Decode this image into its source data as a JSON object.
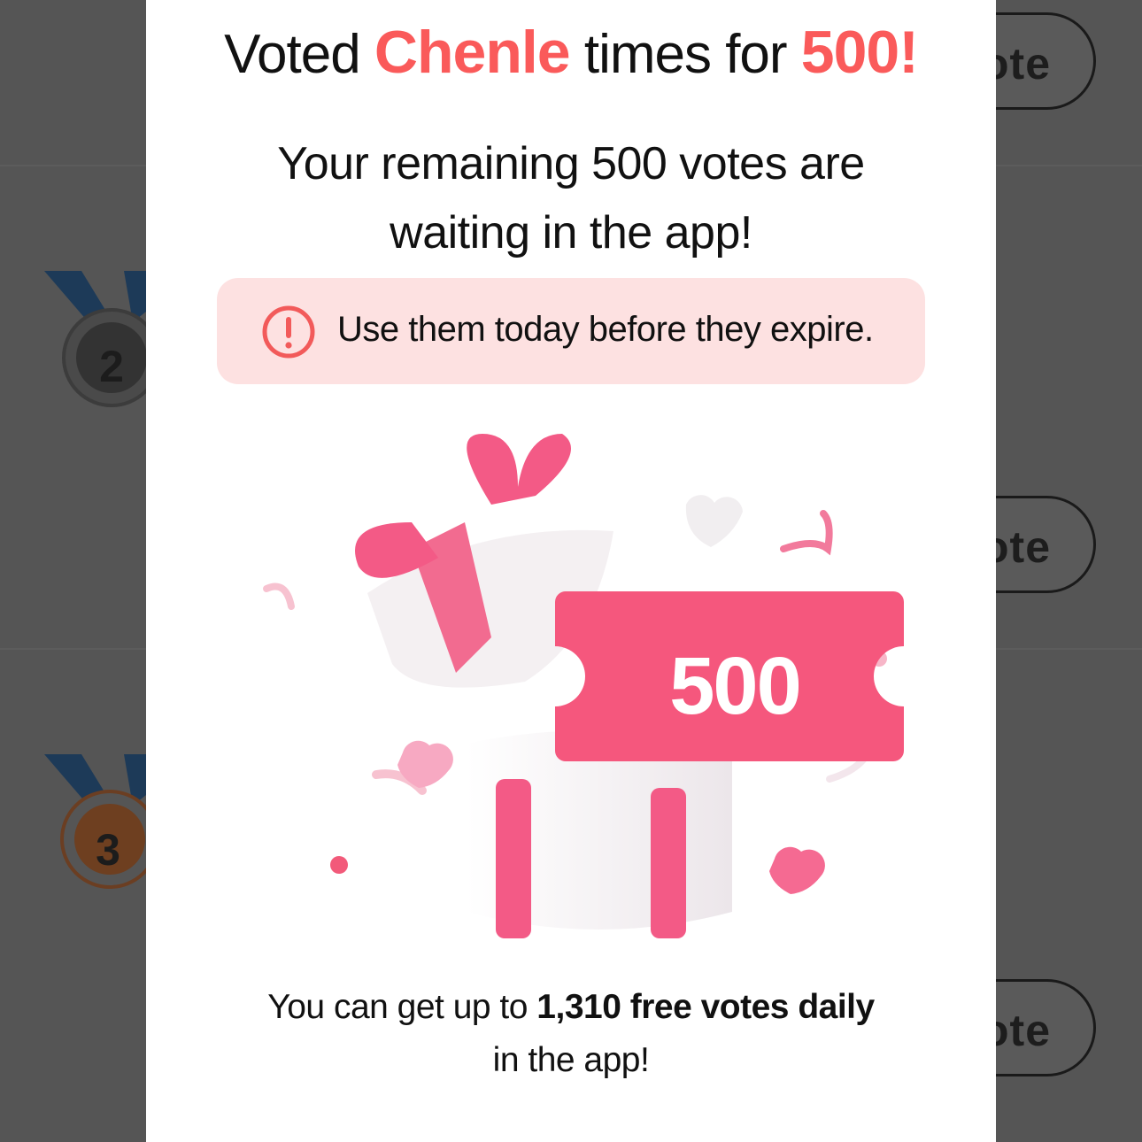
{
  "background": {
    "vote_buttons": [
      "ote",
      "ote",
      "ote"
    ],
    "medals": [
      "2",
      "3"
    ]
  },
  "modal": {
    "title_prefix": "Voted ",
    "title_name": "Chenle",
    "title_middle": " times for ",
    "title_amount": "500!",
    "subtitle_line1": "Your remaining 500 votes are",
    "subtitle_line2": "waiting in the app!",
    "warning_icon": "exclamation-circle-icon",
    "warning_text": "Use them today before they expire.",
    "ticket_value": "500",
    "footer_prefix": "You can get up to ",
    "footer_bold": "1,310 free votes daily",
    "footer_line2": "in the app!"
  },
  "colors": {
    "accent": "#fa5a5a",
    "ticket": "#f5577d",
    "warning_bg": "#fde1e1"
  }
}
